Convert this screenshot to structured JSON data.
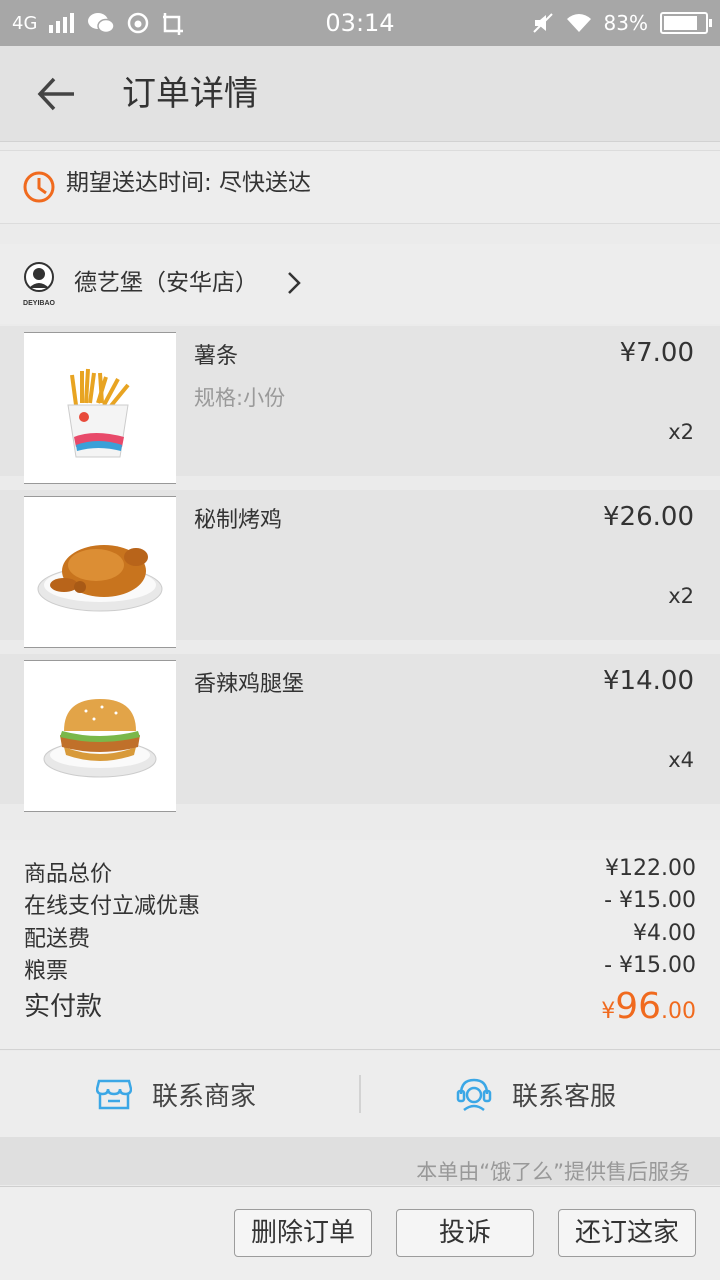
{
  "status_bar": {
    "network": "4G",
    "time": "03:14",
    "battery": "83%",
    "battery_level": 0.83
  },
  "nav": {
    "title": "订单详情"
  },
  "delivery": {
    "text": "期望送达时间: 尽快送达"
  },
  "shop": {
    "name": "德艺堡（安华店）",
    "logo_text": "DEYIBAO"
  },
  "items": [
    {
      "name": "薯条",
      "spec": "规格:小份",
      "price": "¥7.00",
      "qty": "x2",
      "image": "fries"
    },
    {
      "name": "秘制烤鸡",
      "spec": "",
      "price": "¥26.00",
      "qty": "x2",
      "image": "roast-chicken"
    },
    {
      "name": "香辣鸡腿堡",
      "spec": "",
      "price": "¥14.00",
      "qty": "x4",
      "image": "chicken-burger"
    }
  ],
  "totals": {
    "goods_label": "商品总价",
    "goods_value": "¥122.00",
    "discount_label": "在线支付立减优惠",
    "discount_value": "- ¥15.00",
    "delivery_label": "配送费",
    "delivery_value": "¥4.00",
    "coupon_label": "粮票",
    "coupon_value": "- ¥15.00",
    "paid_label": "实付款",
    "paid_currency": "¥",
    "paid_int": "96",
    "paid_dec": ".00"
  },
  "contact": {
    "merchant": "联系商家",
    "service": "联系客服"
  },
  "note": "本单由“饿了么”提供售后服务",
  "actions": {
    "delete": "删除订单",
    "complain": "投诉",
    "reorder": "还订这家"
  },
  "colors": {
    "accent": "#f06a1e",
    "contact_icon": "#3ba7e6"
  }
}
